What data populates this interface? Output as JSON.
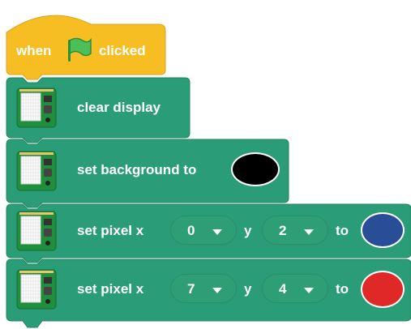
{
  "colors": {
    "event_block": "#f7be23",
    "event_edge": "#d9a21a",
    "display_block": "#2a9d78",
    "display_edge": "#22855f",
    "slot_fill": "#2e9e76"
  },
  "script": {
    "hat": {
      "label_when": "when",
      "label_clicked": "clicked",
      "flag_icon": "green-flag-icon"
    },
    "blocks": [
      {
        "label": "clear display",
        "icon": "sense-hat-board-icon"
      },
      {
        "label": "set background to",
        "icon": "sense-hat-board-icon",
        "color": "#000000"
      },
      {
        "label_prefix": "set pixel x",
        "x_value": "0",
        "y_label": "y",
        "y_value": "2",
        "to_label": "to",
        "color": "#2a4d97",
        "icon": "sense-hat-board-icon"
      },
      {
        "label_prefix": "set pixel x",
        "x_value": "7",
        "y_label": "y",
        "y_value": "4",
        "to_label": "to",
        "color": "#e02828",
        "icon": "sense-hat-board-icon"
      }
    ]
  }
}
